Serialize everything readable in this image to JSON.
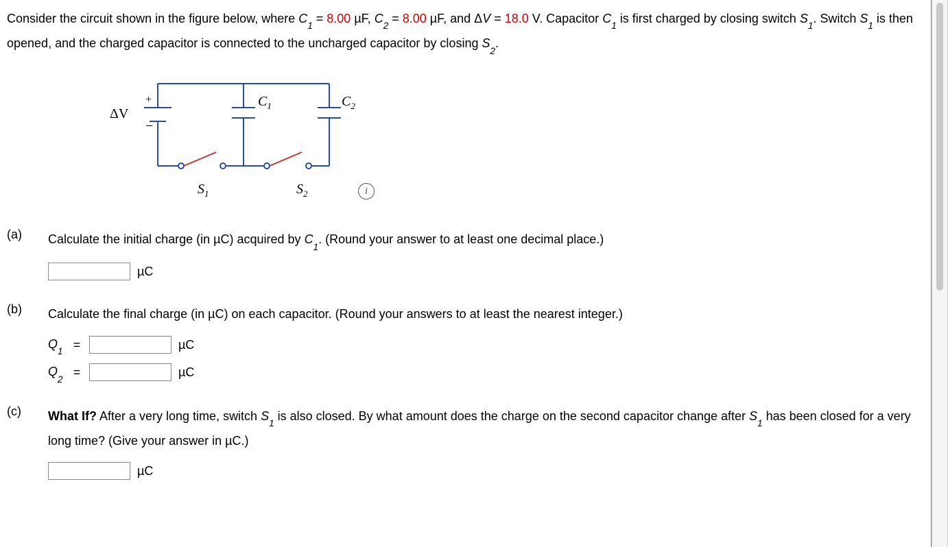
{
  "intro": {
    "pre": "Consider the circuit shown in the figure below, where ",
    "c1_val": "8.00",
    "c2_val": "8.00",
    "dv_val": "18.0",
    "mid1": " µF, ",
    "mid2": " µF, and Δ",
    "mid3": " V. Capacitor ",
    "post": " is first charged by closing switch ",
    "post2": ". Switch ",
    "post3": " is then opened, and the charged capacitor is connected to the uncharged capacitor by closing "
  },
  "figure": {
    "dv_label": "ΔV",
    "plus": "+",
    "minus": "−",
    "c1": "C",
    "c1_sub": "1",
    "c2": "C",
    "c2_sub": "2",
    "s1": "S",
    "s1_sub": "1",
    "s2": "S",
    "s2_sub": "2",
    "info": "i"
  },
  "a": {
    "label": "(a)",
    "prefix": "Calculate the initial charge (in µC) acquired by ",
    "suffix": ". (Round your answer to at least one decimal place.)",
    "unit": "µC"
  },
  "b": {
    "label": "(b)",
    "text": "Calculate the final charge (in µC) on each capacitor. (Round your answers to at least the nearest integer.)",
    "q1": "Q",
    "q1_sub": "1",
    "q2": "Q",
    "q2_sub": "2",
    "eq": "=",
    "unit": "µC"
  },
  "c": {
    "label": "(c)",
    "whatif": "What If?",
    "t1": " After a very long time, switch ",
    "t2": " is also closed. By what amount does the charge on the second capacitor change after ",
    "t3": " has been closed for a very long time? (Give your answer in µC.)",
    "unit": "µC"
  },
  "sym": {
    "C": "C",
    "S": "S",
    "V": "V",
    "eq": " = ",
    "dot": "."
  }
}
